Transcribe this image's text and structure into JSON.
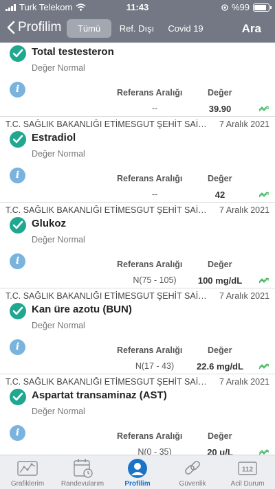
{
  "status_bar": {
    "carrier": "Turk Telekom",
    "time": "11:43",
    "battery": "%99"
  },
  "nav": {
    "back_label": "Profilim",
    "segments": [
      "Tümü",
      "Ref. Dışı",
      "Covid 19"
    ],
    "active_segment": "Tümü",
    "search_label": "Ara"
  },
  "columns": {
    "reference": "Referans Aralığı",
    "value": "Değer"
  },
  "results": [
    {
      "test": "Total testesteron",
      "status": "Değer Normal",
      "reference": "--",
      "value": "39.90"
    },
    {
      "hospital": "T.C. SAĞLIK BAKANLIĞI ETİMESGUT ŞEHİT SAİT ER...",
      "date": "7 Aralık 2021",
      "test": "Estradiol",
      "status": "Değer Normal",
      "reference": "--",
      "value": "42"
    },
    {
      "hospital": "T.C. SAĞLIK BAKANLIĞI ETİMESGUT ŞEHİT SAİT ER...",
      "date": "7 Aralık 2021",
      "test": "Glukoz",
      "status": "Değer Normal",
      "reference": "N(75 - 105)",
      "value": "100 mg/dL"
    },
    {
      "hospital": "T.C. SAĞLIK BAKANLIĞI ETİMESGUT ŞEHİT SAİT ER...",
      "date": "7 Aralık 2021",
      "test": "Kan üre azotu (BUN)",
      "status": "Değer Normal",
      "reference": "N(17 - 43)",
      "value": "22.6 mg/dL"
    },
    {
      "hospital": "T.C. SAĞLIK BAKANLIĞI ETİMESGUT ŞEHİT SAİT ER...",
      "date": "7 Aralık 2021",
      "test": "Aspartat transaminaz (AST)",
      "status": "Değer Normal",
      "reference": "N(0 - 35)",
      "value": "20 u/L"
    }
  ],
  "tabs": [
    {
      "label": "Grafiklerim",
      "icon": "chart-icon"
    },
    {
      "label": "Randevularım",
      "icon": "calendar-icon"
    },
    {
      "label": "Profilim",
      "icon": "profile-icon",
      "active": true
    },
    {
      "label": "Güvenlik",
      "icon": "link-icon"
    },
    {
      "label": "Acil Durum",
      "icon": "emergency-112-icon",
      "badge": "112"
    }
  ],
  "colors": {
    "nav_bg": "#737884",
    "check": "#1fa88f",
    "info": "#7ab3dd",
    "active_tab": "#1a73c7",
    "trend": "#3cb45a"
  }
}
